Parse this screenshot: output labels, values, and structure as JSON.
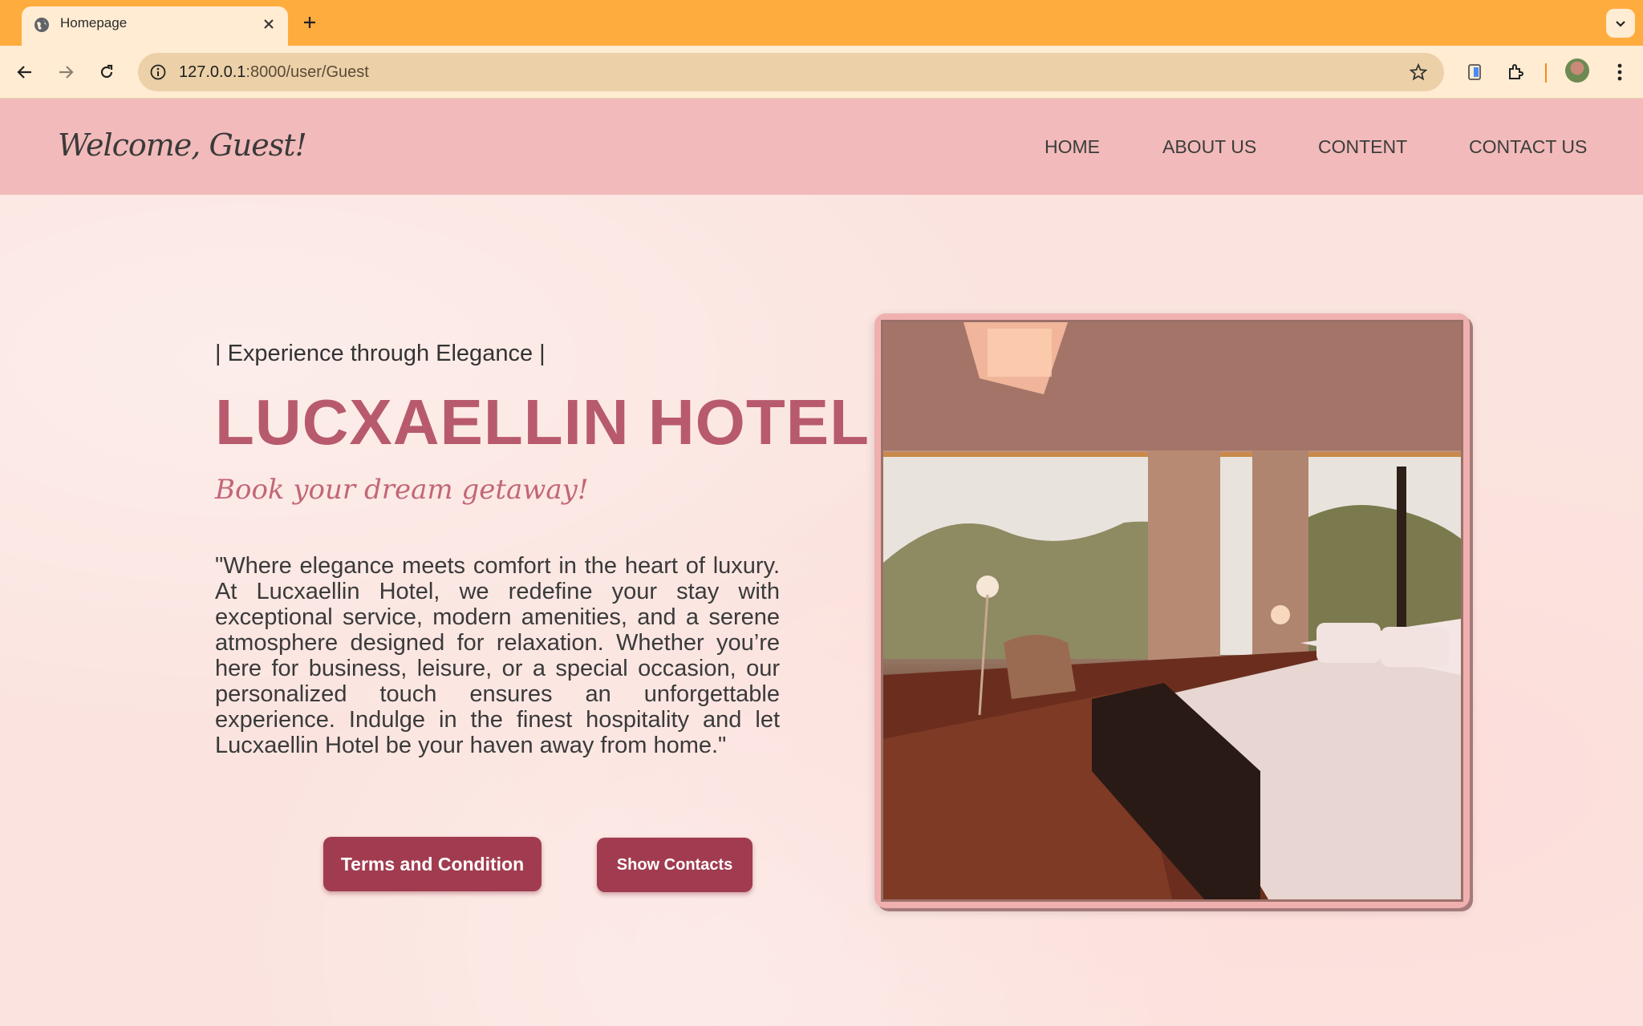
{
  "browser": {
    "tab_title": "Homepage",
    "url_host": "127.0.0.1",
    "url_rest": ":8000/user/Guest"
  },
  "header": {
    "welcome": "Welcome, Guest!",
    "nav": [
      "HOME",
      "ABOUT US",
      "CONTENT",
      "CONTACT US"
    ]
  },
  "hero": {
    "tagline": "| Experience through Elegance |",
    "title": "LUCXAELLIN HOTEL",
    "subtitle": "Book your dream getaway!",
    "description": "\"Where elegance meets comfort in the heart of luxury. At Lucxaellin Hotel, we redefine your stay with exceptional service, modern amenities, and a serene atmosphere designed for relaxation. Whether you’re here for business, leisure, or a special occasion, our personalized touch ensures an unforgettable experience. Indulge in the finest hospitality and let Lucxaellin Hotel be your haven away from home.\"",
    "buttons": {
      "terms": "Terms and Condition",
      "contacts": "Show Contacts"
    }
  },
  "colors": {
    "tabbar": "#ffac3e",
    "header": "#f2baba",
    "accent": "#b85a6e",
    "button": "#a13c50"
  },
  "icons": [
    "globe-icon",
    "close-icon",
    "plus-icon",
    "chevron-down-icon",
    "back-arrow-icon",
    "forward-arrow-icon",
    "reload-icon",
    "site-info-icon",
    "star-icon",
    "tab-search-icon",
    "extensions-icon",
    "kebab-menu-icon"
  ]
}
